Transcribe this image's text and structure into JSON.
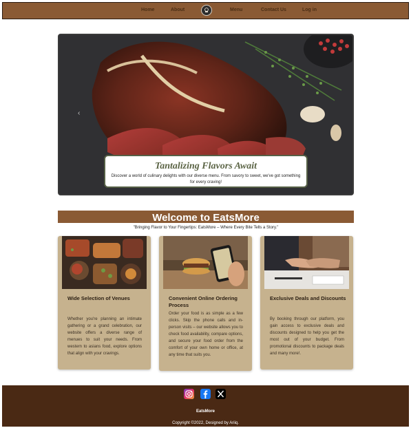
{
  "nav": {
    "items": [
      {
        "label": "Home"
      },
      {
        "label": "About"
      },
      {
        "label": "Menu"
      },
      {
        "label": "Contact Us"
      },
      {
        "label": "Log in"
      }
    ],
    "logo_icon": "chef-logo-icon"
  },
  "hero": {
    "title": "Tantalizing Flavors Await",
    "text": "Discover a world of culinary delights with our diverse menu. From savory to sweet, we've got something for every craving!",
    "prev_icon": "chevron-left-icon"
  },
  "welcome": {
    "heading": "Welcome to EatsMore",
    "tagline": "\"Bringing Flavor to Your Fingertips: EatsMore – Where Every Bite Tells a Story.\""
  },
  "features": [
    {
      "title": "Wide Selection of Venues",
      "text": "Whether you're planning an intimate gathering or a grand celebration, our website offers a diverse range of menues to suit your needs. From western to asians food, explore options that align with your cravings."
    },
    {
      "title": "Convenient Online Ordering Process",
      "text": "Order your food is as simple as a few clicks. Skip the phone calls and in-person visits – our website allows you to check food availability, compare options, and secure your food order from the comfort of your own home or office, at any time that suits you."
    },
    {
      "title": "Exclusive Deals and Discounts",
      "text": "By booking through our platform, you gain access to exclusive deals and discounts designed to help you get the most out of your budget. From promotional discounts to package deals and many more!."
    }
  ],
  "footer": {
    "social": [
      "instagram-icon",
      "facebook-icon",
      "x-twitter-icon"
    ],
    "brand": "EatsMore",
    "copyright": "Copyright ©2022, Designed by Ariiq."
  },
  "colors": {
    "nav_bg": "#8a5a34",
    "card_bg": "#c6b28e",
    "footer_bg": "#4a2914",
    "hero_title": "#5b6445"
  }
}
